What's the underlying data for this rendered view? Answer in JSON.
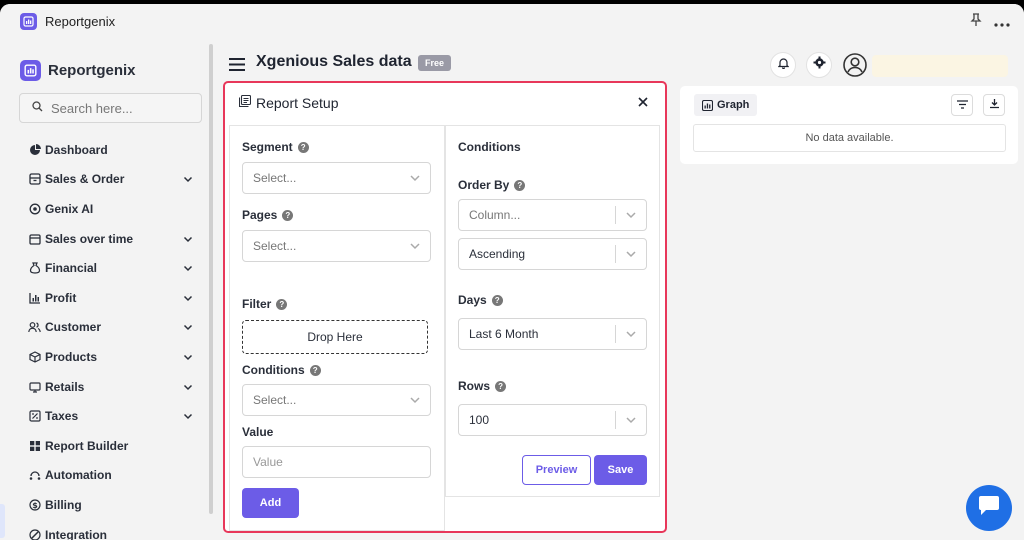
{
  "window": {
    "title": "Reportgenix"
  },
  "sidebar": {
    "brand": "Reportgenix",
    "search_placeholder": "Search here...",
    "items": [
      {
        "label": "Dashboard",
        "icon": "pie-chart-icon",
        "has_submenu": false
      },
      {
        "label": "Sales & Order",
        "icon": "archive-icon",
        "has_submenu": true
      },
      {
        "label": "Genix AI",
        "icon": "ai-spark-icon",
        "has_submenu": false
      },
      {
        "label": "Sales over time",
        "icon": "calendar-icon",
        "has_submenu": true
      },
      {
        "label": "Financial",
        "icon": "money-bag-icon",
        "has_submenu": true
      },
      {
        "label": "Profit",
        "icon": "bar-chart-icon",
        "has_submenu": true
      },
      {
        "label": "Customer",
        "icon": "users-icon",
        "has_submenu": true
      },
      {
        "label": "Products",
        "icon": "box-icon",
        "has_submenu": true
      },
      {
        "label": "Retails",
        "icon": "store-icon",
        "has_submenu": true
      },
      {
        "label": "Taxes",
        "icon": "tax-icon",
        "has_submenu": true
      },
      {
        "label": "Report Builder",
        "icon": "report-grid-icon",
        "has_submenu": false
      },
      {
        "label": "Automation",
        "icon": "automation-icon",
        "has_submenu": false
      },
      {
        "label": "Billing",
        "icon": "dollar-icon",
        "has_submenu": false
      },
      {
        "label": "Integration",
        "icon": "integration-icon",
        "has_submenu": false
      }
    ]
  },
  "header": {
    "title": "Xgenious Sales data",
    "badge": "Free"
  },
  "report_setup": {
    "title": "Report Setup",
    "segment": {
      "label": "Segment",
      "placeholder": "Select..."
    },
    "pages": {
      "label": "Pages",
      "placeholder": "Select..."
    },
    "filter": {
      "label": "Filter",
      "dropzone": "Drop Here"
    },
    "conditions": {
      "label": "Conditions",
      "placeholder": "Select..."
    },
    "value": {
      "label": "Value",
      "placeholder": "Value"
    },
    "add_button": "Add",
    "right": {
      "heading": "Conditions",
      "order_by": {
        "label": "Order By",
        "column_placeholder": "Column...",
        "direction": "Ascending"
      },
      "days": {
        "label": "Days",
        "selected": "Last 6 Month"
      },
      "rows": {
        "label": "Rows",
        "selected": "100"
      },
      "preview_button": "Preview",
      "save_button": "Save"
    }
  },
  "graph": {
    "tab_label": "Graph",
    "empty_text": "No data available."
  },
  "colors": {
    "accent": "#6c5ce7",
    "highlight_border": "#e8375a",
    "chat_button": "#1f6fe5"
  }
}
